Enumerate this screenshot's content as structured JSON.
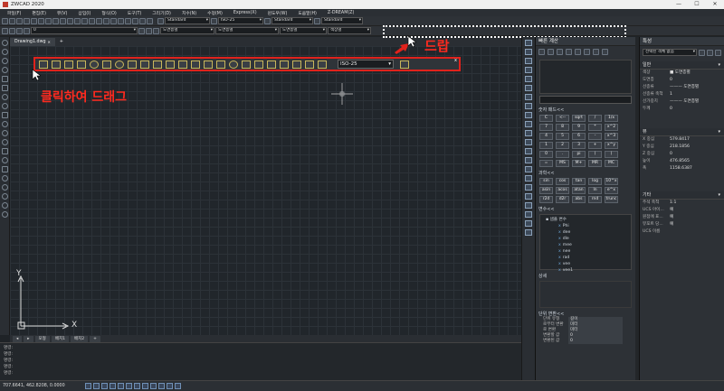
{
  "window": {
    "title": "ZWCAD 2020",
    "minimize": "—",
    "maximize": "☐",
    "close": "✕"
  },
  "menu": [
    "파일(F)",
    "편집(E)",
    "뷰(V)",
    "삽입(I)",
    "형식(O)",
    "도구(T)",
    "그리기(D)",
    "치수(N)",
    "수정(M)",
    "Express(X)",
    "윈도우(W)",
    "도움말(H)",
    "Z-DREAM(Z)"
  ],
  "toolbar": {
    "textstyle": "Standard",
    "dimstyle": "ISO-25",
    "tablestyle": "Standard",
    "mlstyle": "Standard",
    "layer": "0",
    "color": "도면층별",
    "linetype": "도면층별",
    "lineweight": "도면층별",
    "plotstyle": "색상별"
  },
  "doc": {
    "tab": "Drawing1.dwg",
    "close": "✕",
    "plus": "+"
  },
  "float_toolbar": {
    "dimstyle": "ISO-25",
    "close": "x"
  },
  "annotations": {
    "drop": "드랍",
    "drag": "클릭하여 드래그"
  },
  "layout_tabs": [
    "◂",
    "▸",
    "모형",
    "배치1",
    "배치2",
    "+"
  ],
  "command_lines": [
    "명령:",
    "명령:",
    "명령:",
    "명령:",
    "명령:"
  ],
  "status": {
    "coords": "707.6641, 462.8208, 0.0000"
  },
  "calculator": {
    "title": "빠른 계산",
    "numpad_label": "숫자 패드<<",
    "numpad": [
      "C",
      "<--",
      "sqrt",
      "/",
      "1/x",
      "7",
      "8",
      "9",
      "*",
      "x^2",
      "4",
      "5",
      "6",
      "-",
      "x^3",
      "1",
      "2",
      "3",
      "+",
      "x^y",
      "0",
      ".",
      "pi",
      "(",
      ")",
      "=",
      "MS",
      "M+",
      "MR",
      "MC"
    ],
    "sci_label": "과학<<",
    "sci": [
      "sin",
      "cos",
      "tan",
      "log",
      "10^x",
      "asin",
      "acos",
      "atan",
      "ln",
      "e^x",
      "r2d",
      "d2r",
      "abs",
      "rnd",
      "trunc"
    ],
    "var_label": "변수<<",
    "var_root": "샘플 변수",
    "vars": [
      "Phi",
      "dee",
      "dle",
      "mee",
      "nee",
      "rad",
      "vee",
      "vee1"
    ],
    "detail_label": "상세",
    "unit_label": "단위 변환<<",
    "unit_rows": [
      [
        "단위 유형",
        "길이"
      ],
      [
        "로부터 변환",
        "미터"
      ],
      [
        "로 변환",
        "미터"
      ],
      [
        "변환할 값",
        "0"
      ],
      [
        "변환된 값",
        "0"
      ]
    ]
  },
  "properties": {
    "title": "특성",
    "selector": "선택된 객체 없음",
    "groups": [
      {
        "name": "일반",
        "rows": [
          [
            "색상",
            "■ 도면층별"
          ],
          [
            "도면층",
            "0"
          ],
          [
            "선종류",
            "——— 도면층별"
          ],
          [
            "선종류 축척",
            "1"
          ],
          [
            "선가중치",
            "——— 도면층별"
          ],
          [
            "두께",
            "0"
          ]
        ]
      },
      {
        "name": "뷰",
        "rows": [
          [
            "X 중심",
            "579.8417"
          ],
          [
            "Y 중심",
            "218.1856"
          ],
          [
            "Z 중심",
            "0"
          ],
          [
            "높이",
            "476.8565"
          ],
          [
            "폭",
            "1158.6387"
          ]
        ]
      },
      {
        "name": "기타",
        "rows": [
          [
            "주석 축척",
            "1:1"
          ],
          [
            "UCS 아이...",
            "예"
          ],
          [
            "원점에 표...",
            "예"
          ],
          [
            "뷰포트 당...",
            "예"
          ],
          [
            "UCS 이름",
            ""
          ]
        ]
      }
    ]
  },
  "ucs": {
    "x": "X",
    "y": "Y"
  },
  "colors": {
    "accent_red": "#e0221c",
    "canvas": "#21262b"
  }
}
